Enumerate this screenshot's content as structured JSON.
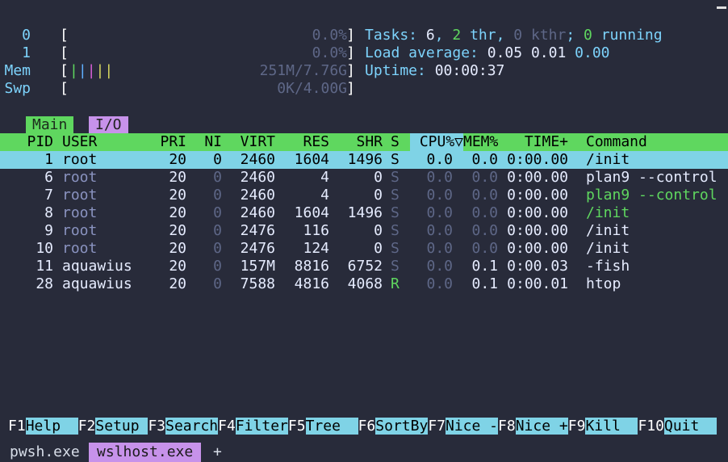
{
  "meters": [
    {
      "label": "0",
      "value": "0.0%",
      "bars": []
    },
    {
      "label": "1",
      "value": "0.0%",
      "bars": []
    },
    {
      "label": "Mem",
      "value": "251M/7.76G",
      "bars": [
        "|",
        "|",
        "|",
        "|",
        "|"
      ]
    },
    {
      "label": "Swp",
      "value": "0K/4.00G",
      "bars": []
    }
  ],
  "info": {
    "tasks_label": "Tasks:",
    "tasks_count": "6",
    "threads": "2",
    "thr_label": "thr",
    "kthreads": "0",
    "kthr_label": "kthr",
    "running": "0",
    "running_label": "running",
    "load_label": "Load average:",
    "load_1": "0.05",
    "load_5": "0.01",
    "load_15": "0.00",
    "uptime_label": "Uptime:",
    "uptime_value": "00:00:37"
  },
  "tabs": {
    "main": "Main",
    "io": "I/O"
  },
  "columns": {
    "pid": "PID",
    "user": "USER",
    "pri": "PRI",
    "ni": "NI",
    "virt": "VIRT",
    "res": "RES",
    "shr": "SHR",
    "s": "S",
    "cpu": "CPU%▽",
    "mem": "MEM%",
    "time": "TIME+",
    "command": "Command"
  },
  "processes": [
    {
      "pid": "1",
      "user": "root",
      "pri": "20",
      "ni": "0",
      "virt": "2460",
      "res": "1604",
      "shr": "1496",
      "s": "S",
      "cpu": "0.0",
      "mem": "0.0",
      "time": "0:00.00",
      "command": "/init"
    },
    {
      "pid": "6",
      "user": "root",
      "pri": "20",
      "ni": "0",
      "virt": "2460",
      "res": "4",
      "shr": "0",
      "s": "S",
      "cpu": "0.0",
      "mem": "0.0",
      "time": "0:00.00",
      "command": "plan9 --control"
    },
    {
      "pid": "7",
      "user": "root",
      "pri": "20",
      "ni": "0",
      "virt": "2460",
      "res": "4",
      "shr": "0",
      "s": "S",
      "cpu": "0.0",
      "mem": "0.0",
      "time": "0:00.00",
      "command": "plan9 --control"
    },
    {
      "pid": "8",
      "user": "root",
      "pri": "20",
      "ni": "0",
      "virt": "2460",
      "res": "1604",
      "shr": "1496",
      "s": "S",
      "cpu": "0.0",
      "mem": "0.0",
      "time": "0:00.00",
      "command": "/init"
    },
    {
      "pid": "9",
      "user": "root",
      "pri": "20",
      "ni": "0",
      "virt": "2476",
      "res": "116",
      "shr": "0",
      "s": "S",
      "cpu": "0.0",
      "mem": "0.0",
      "time": "0:00.00",
      "command": "/init"
    },
    {
      "pid": "10",
      "user": "root",
      "pri": "20",
      "ni": "0",
      "virt": "2476",
      "res": "124",
      "shr": "0",
      "s": "S",
      "cpu": "0.0",
      "mem": "0.0",
      "time": "0:00.00",
      "command": "/init"
    },
    {
      "pid": "11",
      "user": "aquawius",
      "pri": "20",
      "ni": "0",
      "virt": "157M",
      "res": "8816",
      "shr": "6752",
      "s": "S",
      "cpu": "0.0",
      "mem": "0.1",
      "time": "0:00.03",
      "command": "-fish"
    },
    {
      "pid": "28",
      "user": "aquawius",
      "pri": "20",
      "ni": "0",
      "virt": "7588",
      "res": "4816",
      "shr": "4068",
      "s": "R",
      "cpu": "0.0",
      "mem": "0.1",
      "time": "0:00.01",
      "command": "htop"
    }
  ],
  "function_keys": [
    {
      "key": "F1",
      "label": "Help  "
    },
    {
      "key": "F2",
      "label": "Setup "
    },
    {
      "key": "F3",
      "label": "Search"
    },
    {
      "key": "F4",
      "label": "Filter"
    },
    {
      "key": "F5",
      "label": "Tree  "
    },
    {
      "key": "F6",
      "label": "SortBy"
    },
    {
      "key": "F7",
      "label": "Nice -"
    },
    {
      "key": "F8",
      "label": "Nice +"
    },
    {
      "key": "F9",
      "label": "Kill  "
    },
    {
      "key": "F10",
      "label": "Quit  "
    }
  ],
  "terminal_tabs": [
    "pwsh.exe",
    "wslhost.exe"
  ],
  "new_tab": "+",
  "colors": {
    "background": "#282b3a",
    "header_green": "#5fd75f",
    "selection_cyan": "#7fd3e6",
    "accent_purple": "#c792ea",
    "info_cyan": "#7dd3fc"
  }
}
